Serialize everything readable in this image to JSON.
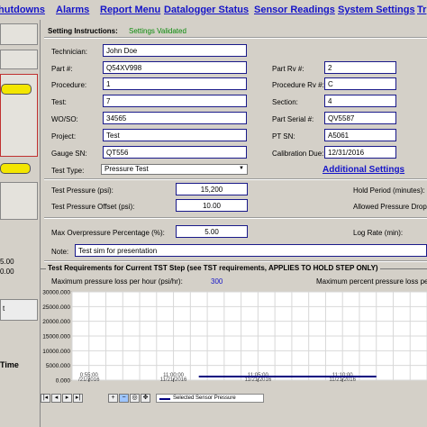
{
  "nav": {
    "items": [
      "hutdowns",
      "Alarms",
      "Report Menu",
      "Datalogger Status",
      "Sensor Readings",
      "System Settings",
      "Tr"
    ]
  },
  "left": {
    "value1": "5.00",
    "value2": "0.00",
    "btn_label": "t",
    "time_label": "Time"
  },
  "settings": {
    "instructions_label": "Setting Instructions:",
    "instructions_value": "Settings Validated",
    "technician": {
      "label": "Technician:",
      "value": "John Doe"
    },
    "part": {
      "label": "Part #:",
      "value": "Q54XV998"
    },
    "procedure": {
      "label": "Procedure:",
      "value": "1"
    },
    "test": {
      "label": "Test:",
      "value": "7"
    },
    "woso": {
      "label": "WO/SO:",
      "value": "34565"
    },
    "project": {
      "label": "Project:",
      "value": "Test"
    },
    "gauge_sn": {
      "label": "Gauge SN:",
      "value": "QT556"
    },
    "part_rv": {
      "label": "Part Rv #:",
      "value": "2"
    },
    "procedure_rv": {
      "label": "Procedure Rv #:",
      "value": "C"
    },
    "section": {
      "label": "Section:",
      "value": "4"
    },
    "part_serial": {
      "label": "Part Serial #:",
      "value": "QV5587"
    },
    "pt_sn": {
      "label": "PT SN:",
      "value": "A5061"
    },
    "calibration_due": {
      "label": "Calibration Due:",
      "value": "12/31/2016"
    },
    "test_type": {
      "label": "Test Type:",
      "value": "Pressure Test"
    },
    "additional_settings": "Additional Settings"
  },
  "pressure": {
    "test_pressure": {
      "label": "Test Pressure (psi):",
      "value": "15,200"
    },
    "test_pressure_offset": {
      "label": "Test Pressure Offset (psi):",
      "value": "10.00"
    },
    "max_overpressure": {
      "label": "Max Overpressure Percentage (%):",
      "value": "5.00"
    },
    "hold_period_label": "Hold Period (minutes):",
    "allowed_drop_label": "Allowed Pressure Drop (",
    "log_rate_label": "Log Rate (min):",
    "note": {
      "label": "Note:",
      "value": "Test sim for presentation"
    }
  },
  "requirements": {
    "title": "Test Requirements for Current TST Step (see TST requirements, APPLIES TO HOLD STEP ONLY)",
    "max_loss_label": "Maximum pressure loss per hour (psi/hr):",
    "max_loss_value": "300",
    "max_pct_label": "Maximum percent pressure loss per"
  },
  "chart_data": {
    "type": "line",
    "title": "",
    "xlabel": "",
    "ylabel": "",
    "y_ticks": [
      "30000.000",
      "25000.000",
      "20000.000",
      "15000.000",
      "10000.000",
      "5000.000",
      "0.000"
    ],
    "ylim": [
      0,
      30000
    ],
    "x_ticks": [
      {
        "time": "0:55:00",
        "date": "/21/2016"
      },
      {
        "time": "11:00:00",
        "date": "11/21/2016"
      },
      {
        "time": "11:05:00",
        "date": "11/21/2016"
      },
      {
        "time": "11:10:00",
        "date": "11/21/2016"
      }
    ],
    "grid": true,
    "legend": "bottom",
    "series": [
      {
        "name": "Selected Sensor Pressure",
        "color": "#000080",
        "x": [
          "11:01:30",
          "11:12:00"
        ],
        "y": [
          0,
          0
        ]
      }
    ]
  },
  "toolbar": {
    "icons": [
      "nav-first-icon",
      "nav-prev-icon",
      "nav-next-icon",
      "nav-last-icon",
      "zoom-in-icon",
      "zoom-out-icon",
      "zoom-reset-icon",
      "pan-icon"
    ]
  }
}
